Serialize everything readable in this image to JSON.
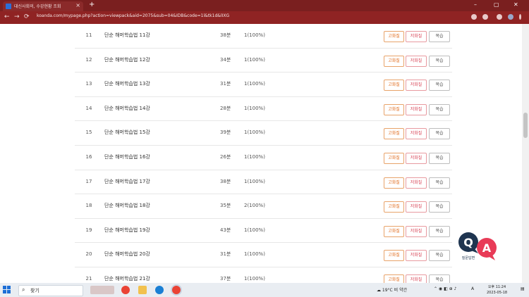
{
  "browser": {
    "tab_title": "대신사회의, 수강현황 조회",
    "tab_close": "×",
    "new_tab": "+",
    "url": "koanda.com/mypage.php?action=viewpack&aid=2075&sub=04&IDB&code=1l&tk1d&lIXG",
    "nav": {
      "back": "←",
      "forward": "→",
      "reload": "⟳"
    },
    "window_controls": {
      "minimize": "–",
      "maximize": "▢",
      "close": "✕"
    }
  },
  "lessons": [
    {
      "num": "11",
      "title": "단순 해머학습법 11강",
      "duration": "38분",
      "progress": "1(100%)"
    },
    {
      "num": "12",
      "title": "단순 해머학습법 12강",
      "duration": "34분",
      "progress": "1(100%)"
    },
    {
      "num": "13",
      "title": "단순 해머학습법 13강",
      "duration": "31분",
      "progress": "1(100%)"
    },
    {
      "num": "14",
      "title": "단순 해머학습법 14강",
      "duration": "28분",
      "progress": "1(100%)"
    },
    {
      "num": "15",
      "title": "단순 해머학습법 15강",
      "duration": "39분",
      "progress": "1(100%)"
    },
    {
      "num": "16",
      "title": "단순 해머학습법 16강",
      "duration": "26분",
      "progress": "1(100%)"
    },
    {
      "num": "17",
      "title": "단순 해머학습법 17강",
      "duration": "38분",
      "progress": "1(100%)"
    },
    {
      "num": "18",
      "title": "단순 해머학습법 18강",
      "duration": "35분",
      "progress": "2(100%)"
    },
    {
      "num": "19",
      "title": "단순 해머학습법 19강",
      "duration": "43분",
      "progress": "1(100%)"
    },
    {
      "num": "20",
      "title": "단순 해머학습법 20강",
      "duration": "31분",
      "progress": "1(100%)"
    },
    {
      "num": "21",
      "title": "단순 해머학습법 21강",
      "duration": "37분",
      "progress": "1(100%)"
    }
  ],
  "buttons": {
    "b1": "고화질",
    "b2": "저화질",
    "b3": "복습"
  },
  "qa_widget": {
    "q": "Q",
    "a": "A",
    "caption": "질문답변"
  },
  "taskbar": {
    "search_placeholder": "찾기",
    "weather": "19°C 비 약간",
    "ime": "A",
    "time": "오후 11:24",
    "date": "2023-05-18"
  }
}
